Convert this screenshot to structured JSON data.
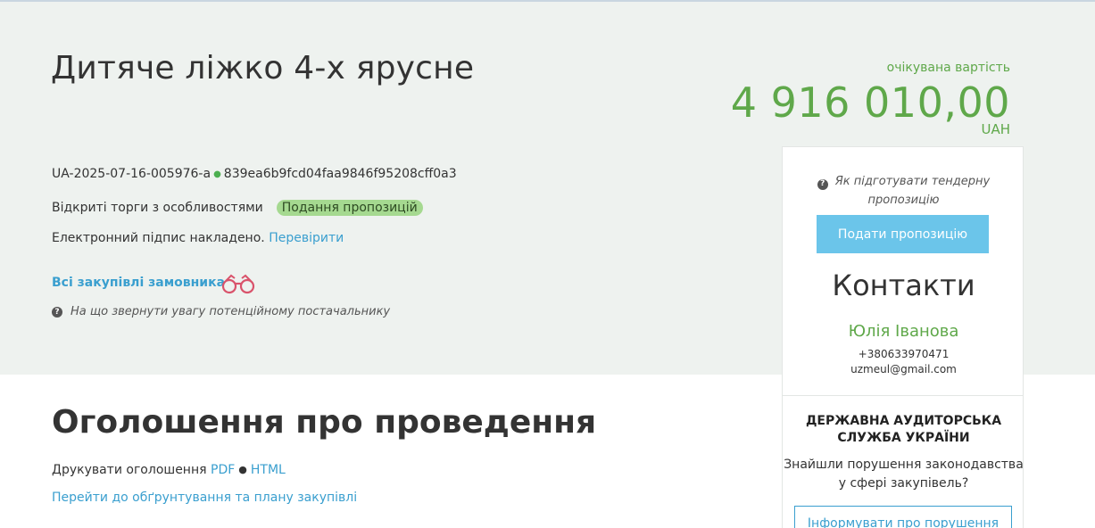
{
  "tender": {
    "title": "Дитяче ліжко 4-х ярусне",
    "tender_id": "UA-2025-07-16-005976-a",
    "hash": "839ea6b9fcd04faa9846f95208cff0a3",
    "procedure_type": "Відкриті торги з особливостями",
    "status": "Подання пропозицій",
    "signature_text": "Електронний підпис накладено.",
    "signature_check_link": "Перевірити",
    "customer_purchases_link": "Всі закупівлі замовника",
    "supplier_hint": "На що звернути увагу потенційному постачальнику"
  },
  "price": {
    "label": "очікувана вартість",
    "value": "4 916 010,00",
    "currency": "UAH"
  },
  "side_panel": {
    "howto": "Як підготувати тендерну пропозицію",
    "submit_button": "Подати пропозицію",
    "contacts_title": "Контакти",
    "contact_name": "Юлія Іванова",
    "contact_phone": "+380633970471",
    "contact_email": "uzmeul@gmail.com",
    "audit_title": "ДЕРЖАВНА АУДИТОРСЬКА СЛУЖБА УКРАЇНИ",
    "audit_text": "Знайшли порушення законодавства у сфері закупівель?",
    "report_button": "Інформувати про порушення"
  },
  "announcement": {
    "title": "Оголошення про проведення",
    "print_label": "Друкувати оголошення",
    "pdf_link": "PDF",
    "html_link": "HTML",
    "plan_link": "Перейти до обґрунтування та плану закупівлі"
  },
  "colors": {
    "band_bg": "#eef2ef",
    "accent_green": "#5fa84a",
    "link_blue": "#3a9fcf",
    "badge_green": "#a5d990",
    "button_blue": "#6bc5ea"
  },
  "icons": [
    "question-icon",
    "binoculars-icon",
    "green-dot-icon"
  ]
}
